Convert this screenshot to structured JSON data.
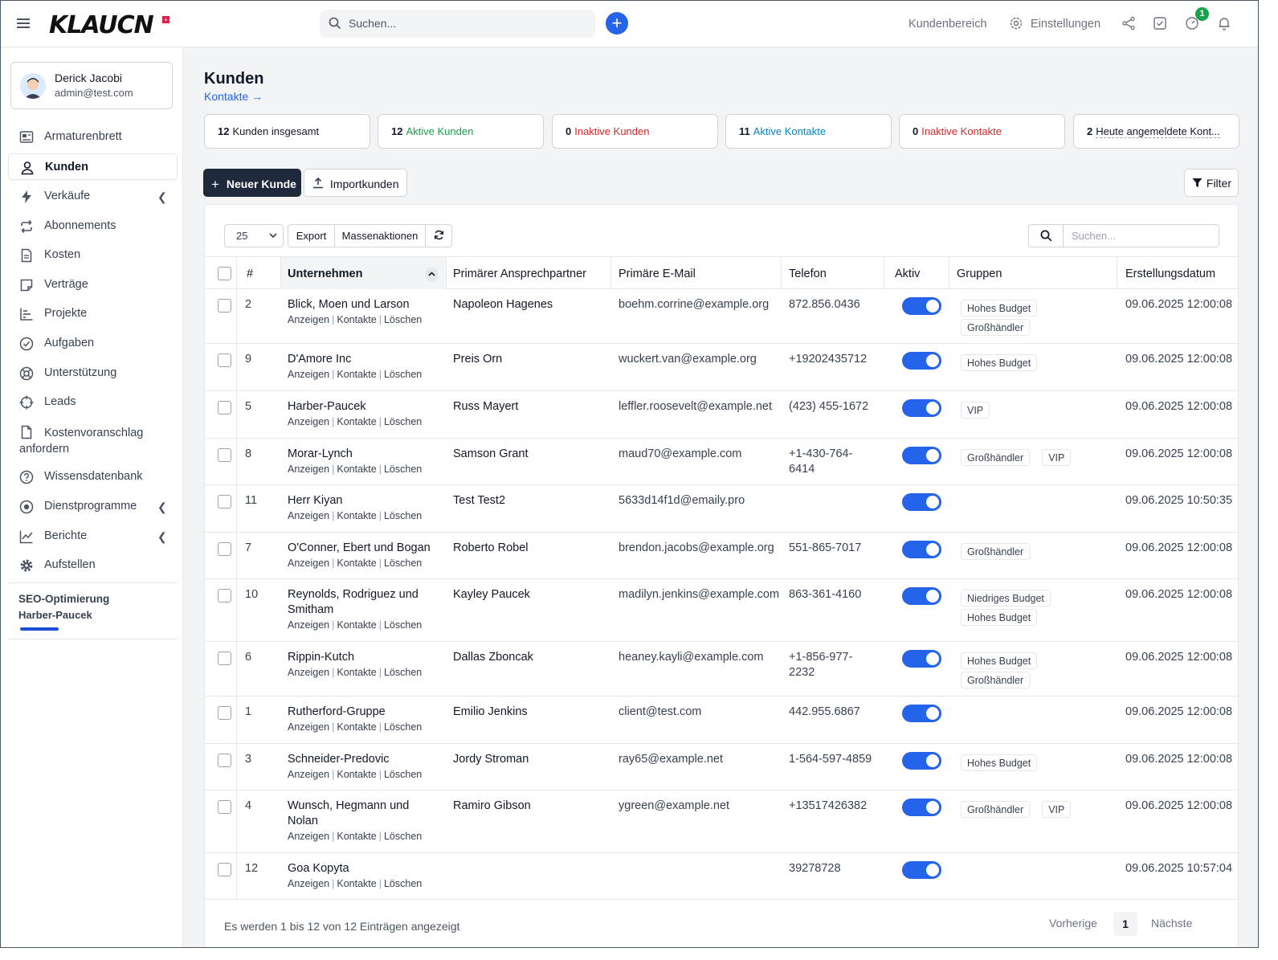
{
  "app": {
    "logo": "KLAUCN",
    "logo_flag": "+"
  },
  "header": {
    "search_placeholder": "Suchen...",
    "customer_area": "Kundenbereich",
    "settings": "Einstellungen",
    "notif_badge": "1"
  },
  "profile": {
    "name": "Derick Jacobi",
    "email": "admin@test.com"
  },
  "sidebar": {
    "items": [
      {
        "label": "Armaturenbrett",
        "icon": "dashboard-icon"
      },
      {
        "label": "Kunden",
        "icon": "user-icon",
        "active": true
      },
      {
        "label": "Verkäufe",
        "icon": "bolt-icon",
        "submenu": true
      },
      {
        "label": "Abonnements",
        "icon": "repeat-icon"
      },
      {
        "label": "Kosten",
        "icon": "document-icon"
      },
      {
        "label": "Verträge",
        "icon": "contract-icon"
      },
      {
        "label": "Projekte",
        "icon": "chart-bar-icon"
      },
      {
        "label": "Aufgaben",
        "icon": "check-circle-icon"
      },
      {
        "label": "Unterstützung",
        "icon": "lifebuoy-icon"
      },
      {
        "label": "Leads",
        "icon": "crosshair-icon"
      },
      {
        "label": "Kostenvoranschlag anfordern",
        "icon": "file-icon"
      },
      {
        "label": "Wissensdatenbank",
        "icon": "question-icon"
      },
      {
        "label": "Dienstprogramme",
        "icon": "dot-circle-icon",
        "submenu": true
      },
      {
        "label": "Berichte",
        "icon": "line-chart-icon",
        "submenu": true
      },
      {
        "label": "Aufstellen",
        "icon": "gear-icon"
      }
    ],
    "project": {
      "title": "SEO-Optimierung",
      "client": "Harber-Paucek",
      "progress": 0.22
    }
  },
  "page": {
    "title": "Kunden",
    "link": "Kontakte →"
  },
  "stats": [
    {
      "count": "12",
      "label": "Kunden insgesamt",
      "color": "#111827"
    },
    {
      "count": "12",
      "label": "Aktive Kunden",
      "color": "#16a34a"
    },
    {
      "count": "0",
      "label": "Inaktive Kunden",
      "color": "#dc2626"
    },
    {
      "count": "11",
      "label": "Aktive Kontakte",
      "color": "#0284c7"
    },
    {
      "count": "0",
      "label": "Inaktive Kontakte",
      "color": "#dc2626"
    },
    {
      "count": "2",
      "label": "Heute angemeldete Kont...",
      "color": "#111827"
    }
  ],
  "actions": {
    "new": "Neuer Kunde",
    "import": "Importkunden",
    "filter": "Filter"
  },
  "table": {
    "page_size": "25",
    "export": "Export",
    "bulk": "Massenaktionen",
    "search_placeholder": "Suchen...",
    "columns": [
      "#",
      "Unternehmen",
      "Primärer Ansprechpartner",
      "Primäre E-Mail",
      "Telefon",
      "Aktiv",
      "Gruppen",
      "Erstellungsdatum"
    ],
    "row_actions": [
      "Anzeigen",
      "Kontakte",
      "Löschen"
    ],
    "rows": [
      {
        "id": "2",
        "company": [
          "Blick, Moen und Larson"
        ],
        "contact": "Napoleon Hagenes",
        "email": "boehm.corrine@example.org",
        "phone": [
          "872.856.0436"
        ],
        "active": true,
        "groups": [
          "Hohes Budget",
          "Großhändler"
        ],
        "groups_stacked": true,
        "created": "09.06.2025 12:00:08"
      },
      {
        "id": "9",
        "company": [
          "D'Amore Inc"
        ],
        "contact": "Preis Orn",
        "email": "wuckert.van@example.org",
        "phone": [
          "+19202435712"
        ],
        "active": true,
        "groups": [
          "Hohes Budget"
        ],
        "created": "09.06.2025 12:00:08"
      },
      {
        "id": "5",
        "company": [
          "Harber-Paucek"
        ],
        "contact": "Russ Mayert",
        "email": "leffler.roosevelt@example.net",
        "phone": [
          "(423) 455-1672"
        ],
        "active": true,
        "groups": [
          "VIP"
        ],
        "created": "09.06.2025 12:00:08"
      },
      {
        "id": "8",
        "company": [
          "Morar-Lynch"
        ],
        "contact": "Samson Grant",
        "email": "maud70@example.com",
        "phone": [
          "+1-430-764-",
          "6414"
        ],
        "active": true,
        "groups": [
          "Großhändler",
          "VIP"
        ],
        "created": "09.06.2025 12:00:08"
      },
      {
        "id": "11",
        "company": [
          "Herr Kiyan"
        ],
        "contact": "Test Test2",
        "email": "5633d14f1d@emaily.pro",
        "phone": [],
        "active": true,
        "groups": [],
        "created": "09.06.2025 10:50:35"
      },
      {
        "id": "7",
        "company": [
          "O'Conner, Ebert und Bogan"
        ],
        "contact": "Roberto Robel",
        "email": "brendon.jacobs@example.org",
        "phone": [
          "551-865-7017"
        ],
        "active": true,
        "groups": [
          "Großhändler"
        ],
        "created": "09.06.2025 12:00:08"
      },
      {
        "id": "10",
        "company": [
          "Reynolds, Rodriguez und",
          "Smitham"
        ],
        "contact": "Kayley Paucek",
        "email": "madilyn.jenkins@example.com",
        "phone": [
          "863-361-4160"
        ],
        "active": true,
        "groups": [
          "Niedriges Budget",
          "Hohes Budget"
        ],
        "groups_stacked": true,
        "created": "09.06.2025 12:00:08"
      },
      {
        "id": "6",
        "company": [
          "Rippin-Kutch"
        ],
        "contact": "Dallas Zboncak",
        "email": "heaney.kayli@example.com",
        "phone": [
          "+1-856-977-",
          "2232"
        ],
        "active": true,
        "groups": [
          "Hohes Budget",
          "Großhändler"
        ],
        "groups_stacked": true,
        "created": "09.06.2025 12:00:08"
      },
      {
        "id": "1",
        "company": [
          "Rutherford-Gruppe"
        ],
        "contact": "Emilio Jenkins",
        "email": "client@test.com",
        "phone": [
          "442.955.6867"
        ],
        "active": true,
        "groups": [],
        "created": "09.06.2025 12:00:08"
      },
      {
        "id": "3",
        "company": [
          "Schneider-Predovic"
        ],
        "contact": "Jordy Stroman",
        "email": "ray65@example.net",
        "phone": [
          "1-564-597-4859"
        ],
        "active": true,
        "groups": [
          "Hohes Budget"
        ],
        "created": "09.06.2025 12:00:08"
      },
      {
        "id": "4",
        "company": [
          "Wunsch, Hegmann und",
          "Nolan"
        ],
        "contact": "Ramiro Gibson",
        "email": "ygreen@example.net",
        "phone": [
          "+13517426382"
        ],
        "active": true,
        "groups": [
          "Großhändler",
          "VIP"
        ],
        "created": "09.06.2025 12:00:08"
      },
      {
        "id": "12",
        "company": [
          "Goa Kopyta"
        ],
        "contact": "",
        "email": "",
        "phone": [
          "39278728"
        ],
        "active": true,
        "groups": [],
        "created": "09.06.2025 10:57:04"
      }
    ],
    "footer": "Es werden 1 bis 12 von 12 Einträgen angezeigt",
    "prev": "Vorherige",
    "current_page": "1",
    "next": "Nächste"
  }
}
